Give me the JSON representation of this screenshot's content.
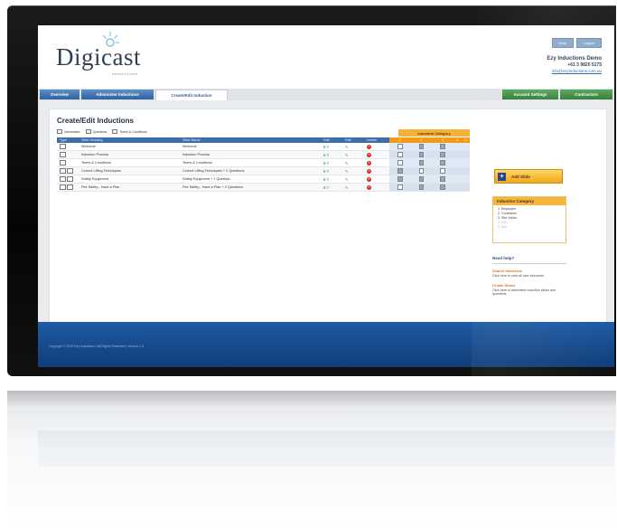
{
  "header": {
    "logo_text": "Digicast",
    "logo_sub": "PRODUCTIONS",
    "top_buttons": [
      "Help",
      "Logout"
    ],
    "account_name": "Ezy Inductions Demo",
    "account_phone": "+61 3 9820 5175",
    "account_email": "info@ezyinductions.com.au"
  },
  "nav": {
    "tabs": [
      "Overview",
      "Administer Inductions",
      "Create/Edit Induction"
    ],
    "right_tabs": [
      "Account Settings",
      "Contractors"
    ]
  },
  "main": {
    "title": "Create/Edit Inductions",
    "legend": [
      "Information",
      "Questions",
      "Terms & Conditions"
    ],
    "category_header": "Induction Category",
    "columns": [
      "Type",
      "Slide Heading",
      "Slide Name",
      "Edit",
      "Edit",
      "Delete"
    ],
    "category_columns": [
      "1",
      "2",
      "3",
      "4",
      "5"
    ],
    "rows": [
      {
        "heading": "Welcome",
        "name": "Welcome",
        "edit": "E T"
      },
      {
        "heading": "Induction Process",
        "name": "Induction Process",
        "edit": "E T"
      },
      {
        "heading": "Terms & Conditions",
        "name": "Terms & Conditions",
        "edit": "E T"
      },
      {
        "heading": "Correct Lifting Techniques",
        "name": "Correct Lifting Techniques + 2 Questions",
        "edit": "E T"
      },
      {
        "heading": "Safety Equipment",
        "name": "Safety Equipment + 1 Question",
        "edit": "E T"
      },
      {
        "heading": "Fire Safety - Have a Plan",
        "name": "Fire Safety - Have a Plan + 2 Questions",
        "edit": "E T"
      }
    ]
  },
  "sidebar": {
    "add_button": "Add Slide",
    "category_title": "Induction Category",
    "categories": [
      "1. Employee",
      "2. Contractor",
      "3. Site Visitor",
      "4. N/A",
      "5. N/A"
    ],
    "help_title": "Need help?",
    "links": [
      {
        "title": "Search Inductees",
        "desc": "Click here to view all user inductees"
      },
      {
        "title": "Create Slides",
        "desc": "Click here to administer induction slides and questions"
      }
    ]
  },
  "footer": {
    "text": "Copyright © 2010 Ezy Inductions | All Rights Reserved | Version 1.0"
  },
  "colors": {
    "nav_blue": "#2f62a0",
    "accent_orange": "#f6b233",
    "delete_red": "#d9261c",
    "footer_blue": "#1f5aa4"
  }
}
